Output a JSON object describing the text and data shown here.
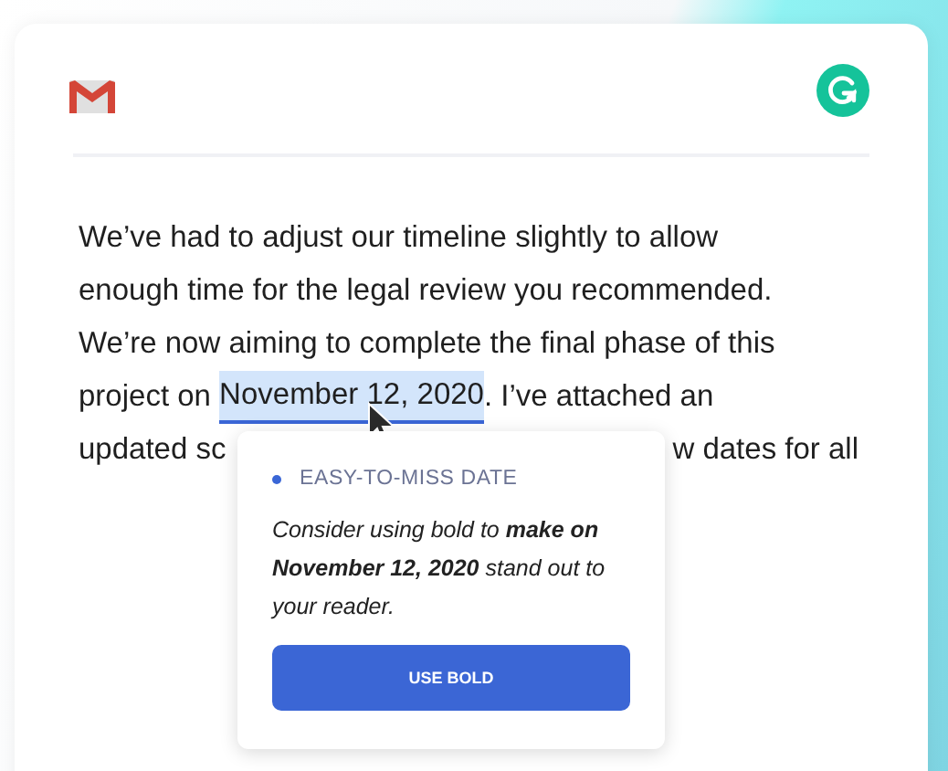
{
  "email": {
    "lines": [
      "We’ve had to adjust our timeline slightly to allow",
      "enough time for the legal review you recommended.",
      "We’re now aiming to complete the final phase of this"
    ],
    "highlight_line": {
      "before": "project on ",
      "highlight": "November 12, 2020",
      "after": ". I’ve attached an"
    },
    "last_line": {
      "start": "updated sc",
      "end": "w dates for all"
    }
  },
  "suggestion": {
    "category": "EASY-TO-MISS DATE",
    "message": "Consider using bold to **make on November 12, 2020** stand out to your reader.",
    "button": "USE BOLD"
  }
}
